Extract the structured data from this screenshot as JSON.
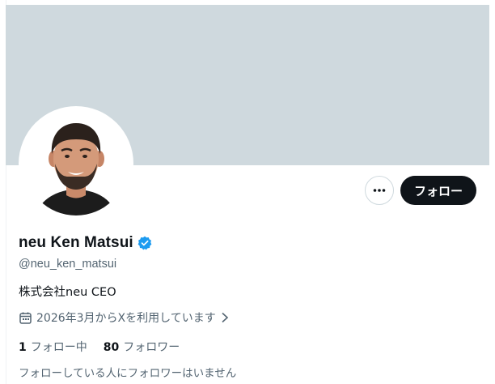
{
  "profile": {
    "display_name": "neu Ken Matsui",
    "handle": "@neu_ken_matsui",
    "bio": "株式会社neu CEO",
    "joined": "2026年3月からXを利用しています",
    "verified": true,
    "verified_color": "#1d9bf0"
  },
  "actions": {
    "follow_label": "フォロー",
    "more_icon": "more-horizontal-icon"
  },
  "stats": {
    "following_count": "1",
    "following_label": "フォロー中",
    "followers_count": "80",
    "followers_label": "フォロワー"
  },
  "mutuals": {
    "text": "フォローしている人にフォロワーはいません"
  },
  "colors": {
    "banner": "#cfd9de",
    "primary_text": "#0f1419",
    "secondary_text": "#536471",
    "follow_button_bg": "#0f1419"
  }
}
